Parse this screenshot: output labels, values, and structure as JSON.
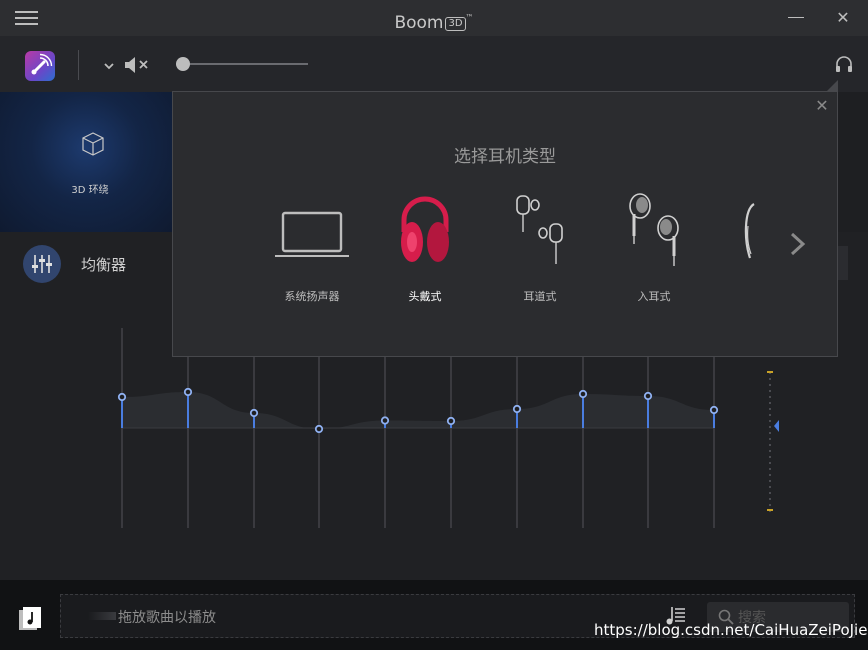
{
  "app": {
    "title": "Boom",
    "badge": "3D",
    "trademark": "™"
  },
  "toolbar": {
    "volume_level": 0.05,
    "muted": true
  },
  "surround": {
    "label": "3D 环绕"
  },
  "equalizer": {
    "label": "均衡器",
    "band_levels": [
      0.62,
      0.72,
      0.3,
      -0.02,
      0.15,
      0.14,
      0.38,
      0.68,
      0.64,
      0.36
    ]
  },
  "popup": {
    "title": "选择耳机类型",
    "options": [
      {
        "label": "系统扬声器",
        "icon": "laptop-icon",
        "selected": false
      },
      {
        "label": "头戴式",
        "icon": "over-ear-headphones-icon",
        "selected": true
      },
      {
        "label": "耳道式",
        "icon": "in-ear-canal-earbuds-icon",
        "selected": false
      },
      {
        "label": "入耳式",
        "icon": "earbuds-icon",
        "selected": false
      }
    ]
  },
  "bottom": {
    "drop_hint": "拖放歌曲以播放",
    "search_placeholder": "搜索"
  },
  "watermark": "https://blog.csdn.net/CaiHuaZeiPoJie",
  "colors": {
    "accent": "#4a7de0",
    "headphone_red": "#d61d4b",
    "background": "#202124"
  }
}
